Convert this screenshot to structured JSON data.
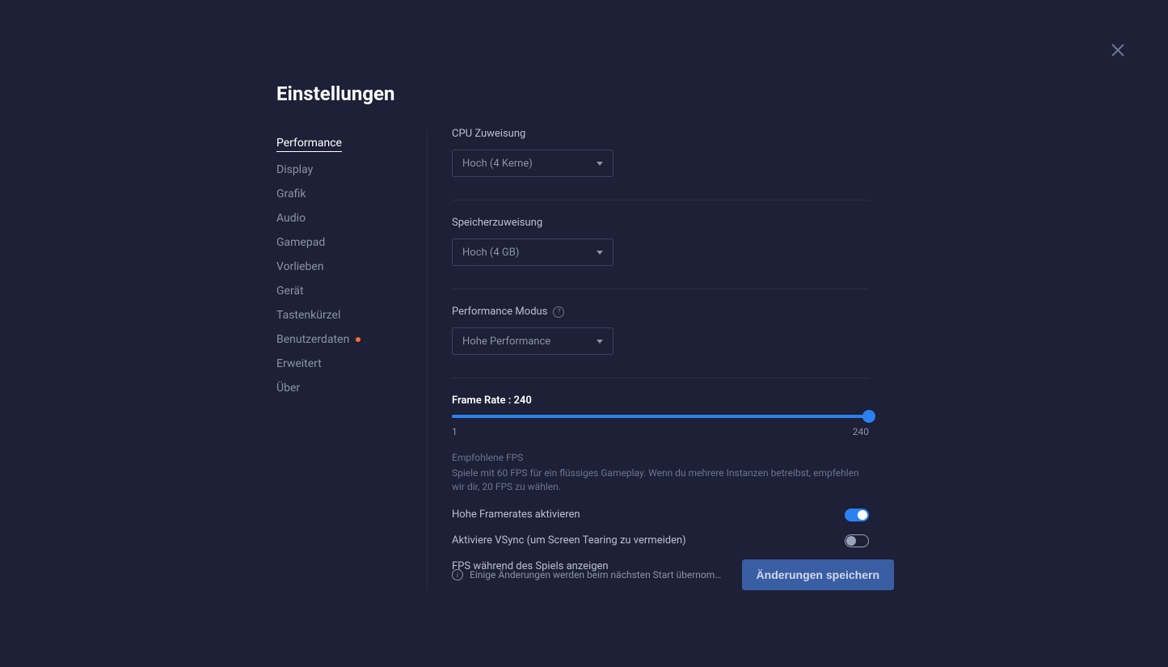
{
  "page_title": "Einstellungen",
  "sidebar": {
    "items": [
      {
        "label": "Performance",
        "active": true,
        "dot": false
      },
      {
        "label": "Display",
        "active": false,
        "dot": false
      },
      {
        "label": "Grafik",
        "active": false,
        "dot": false
      },
      {
        "label": "Audio",
        "active": false,
        "dot": false
      },
      {
        "label": "Gamepad",
        "active": false,
        "dot": false
      },
      {
        "label": "Vorlieben",
        "active": false,
        "dot": false
      },
      {
        "label": "Gerät",
        "active": false,
        "dot": false
      },
      {
        "label": "Tastenkürzel",
        "active": false,
        "dot": false
      },
      {
        "label": "Benutzerdaten",
        "active": false,
        "dot": true
      },
      {
        "label": "Erweitert",
        "active": false,
        "dot": false
      },
      {
        "label": "Über",
        "active": false,
        "dot": false
      }
    ]
  },
  "fields": {
    "cpu": {
      "label": "CPU Zuweisung",
      "value": "Hoch (4 Kerne)"
    },
    "memory": {
      "label": "Speicherzuweisung",
      "value": "Hoch (4 GB)"
    },
    "perfmode": {
      "label": "Performance Modus",
      "value": "Hohe Performance"
    }
  },
  "slider": {
    "label": "Frame Rate : 240",
    "min": "1",
    "max": "240",
    "value": 240
  },
  "hint": {
    "title": "Empfohlene FPS",
    "body": "Spiele mit 60 FPS für ein flüssiges Gameplay. Wenn du mehrere Instanzen betreibst, empfehlen wir dir, 20 FPS zu wählen."
  },
  "toggles": [
    {
      "label": "Hohe Framerates aktivieren",
      "on": true
    },
    {
      "label": "Aktiviere VSync (um Screen Tearing zu vermeiden)",
      "on": false
    },
    {
      "label": "FPS während des Spiels anzeigen",
      "on": false
    }
  ],
  "footer": {
    "note": "Einige Änderungen werden beim nächsten Start übernom…",
    "save_label": "Änderungen speichern"
  }
}
